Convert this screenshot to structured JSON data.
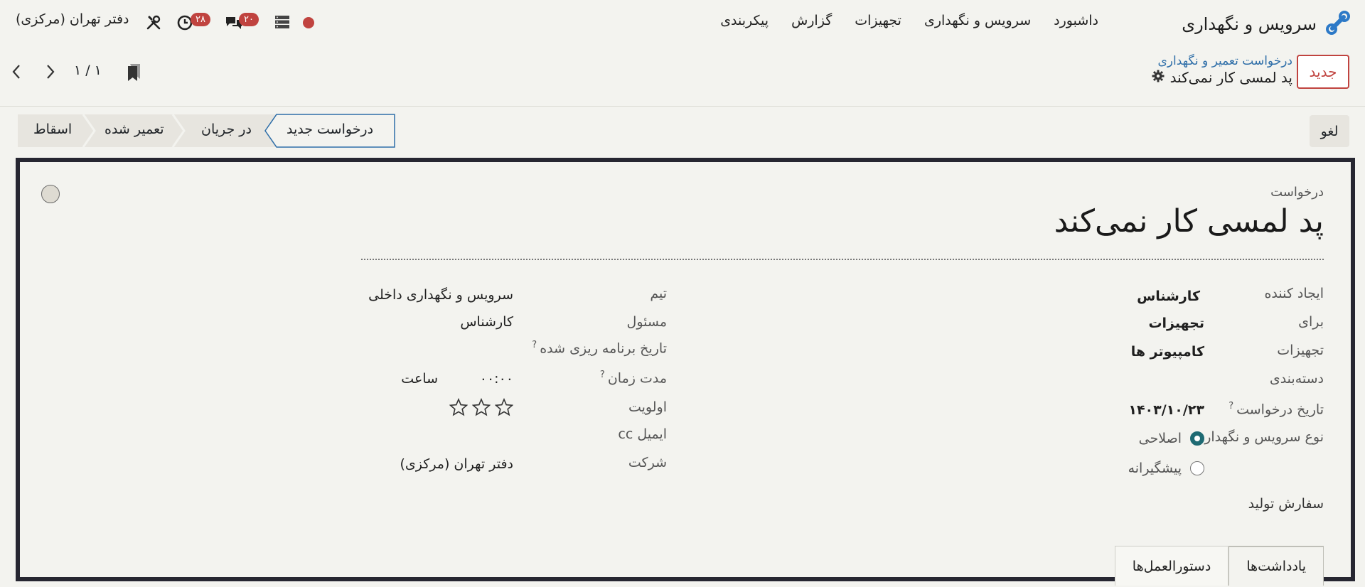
{
  "navbar": {
    "app_name": "سرویس و نگهداری",
    "menu": [
      "داشبورد",
      "سرویس و نگهداری",
      "تجهیزات",
      "گزارش",
      "پیکربندی"
    ],
    "company": "دفتر تهران (مرکزی)",
    "activity_count": "۲۸",
    "message_count": "۲۰"
  },
  "control_panel": {
    "new_label": "جدید",
    "breadcrumb_parent": "درخواست تعمیر و نگهداری",
    "breadcrumb_current": "پد لمسی کار نمی‌کند",
    "pager": "۱ / ۱"
  },
  "statusbar": {
    "cancel_label": "لغو",
    "stages": [
      "درخواست جدید",
      "در جریان",
      "تعمیر شده",
      "اسقاط"
    ],
    "active_stage": 0
  },
  "form": {
    "request_label": "درخواست",
    "title": "پد لمسی کار نمی‌کند",
    "right": {
      "created_by_label": "ایجاد کننده",
      "created_by": "کارشناس",
      "for_label": "برای",
      "for": "تجهیزات",
      "equipment_label": "تجهیزات",
      "equipment": "کامپیوتر ها",
      "category_label": "دسته‌بندی",
      "request_date_label": "تاریخ درخواست",
      "request_date": "۱۴۰۳/۱۰/۲۳",
      "maintenance_type_label": "نوع سرویس و نگهداری",
      "type_corrective": "اصلاحی",
      "type_preventive": "پیشگیرانه",
      "type_selected": "corrective",
      "production_order_label": "سفارش تولید"
    },
    "left": {
      "team_label": "تیم",
      "team": "سرویس و نگهداری داخلی",
      "responsible_label": "مسئول",
      "responsible": "کارشناس",
      "scheduled_date_label": "تاریخ برنامه ریزی شده",
      "duration_label": "مدت زمان",
      "duration": "۰۰:۰۰",
      "duration_unit": "ساعت",
      "priority_label": "اولویت",
      "priority": 0,
      "email_cc_label": "ایمیل cc",
      "company_label": "شرکت",
      "company": "دفتر تهران (مرکزی)"
    },
    "tabs": [
      "یادداشت‌ها",
      "دستورالعمل‌ها"
    ],
    "active_tab": 0
  },
  "colors": {
    "accent": "#c0433f",
    "radio_selected": "#1e6a73",
    "link": "#2e6ea8",
    "sheet_border": "#262631"
  }
}
